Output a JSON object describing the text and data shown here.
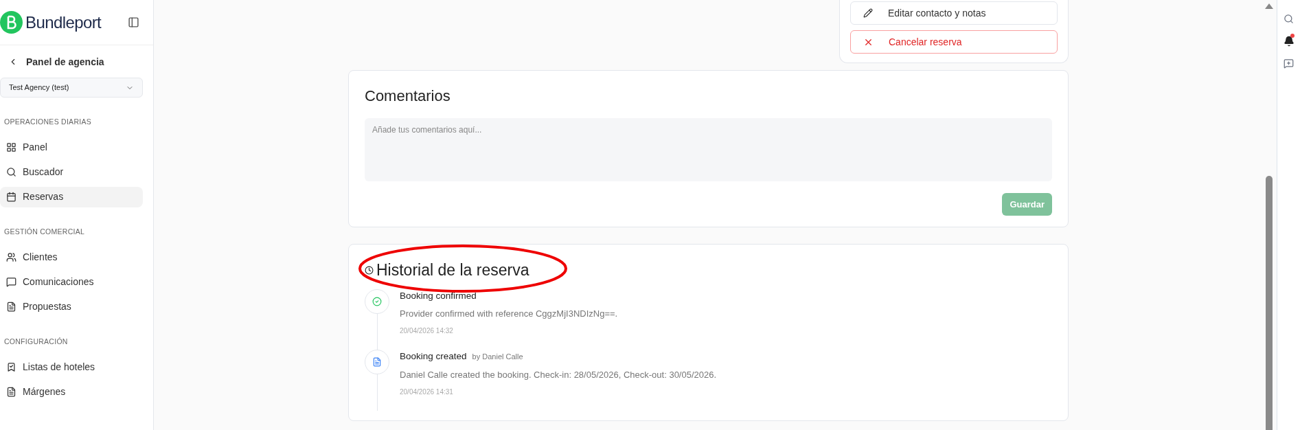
{
  "sidebar": {
    "brand": "Bundleport",
    "back_label": "Panel de agencia",
    "agency_select": "Test Agency (test)",
    "sections": [
      {
        "title": "OPERACIONES DIARIAS",
        "items": [
          {
            "label": "Panel",
            "selected": false
          },
          {
            "label": "Buscador",
            "selected": false
          },
          {
            "label": "Reservas",
            "selected": true
          }
        ]
      },
      {
        "title": "GESTIÓN COMERCIAL",
        "items": [
          {
            "label": "Clientes",
            "selected": false
          },
          {
            "label": "Comunicaciones",
            "selected": false
          },
          {
            "label": "Propuestas",
            "selected": false
          }
        ]
      },
      {
        "title": "CONFIGURACIÓN",
        "items": [
          {
            "label": "Listas de hoteles",
            "selected": false
          },
          {
            "label": "Márgenes",
            "selected": false
          }
        ]
      }
    ]
  },
  "actions": [
    {
      "label": "Editar contacto y notas",
      "kind": "default"
    },
    {
      "label": "Cancelar reserva",
      "kind": "danger"
    }
  ],
  "comments": {
    "title": "Comentarios",
    "placeholder": "Añade tus comentarios aquí...",
    "save_button": "Guardar",
    "save_disabled": true
  },
  "history": {
    "title": "Historial de la reserva",
    "events": [
      {
        "kind": "confirmed",
        "title": "Booking confirmed",
        "description": "Provider confirmed with reference CggzMjI3NDIzNg==.",
        "time": "20/04/2026 14:32"
      },
      {
        "kind": "created",
        "title": "Booking created",
        "by": "by Daniel Calle",
        "description": "Daniel Calle created the booking. Check-in: 28/05/2026, Check-out: 30/05/2026.",
        "time": "20/04/2026 14:31"
      }
    ]
  },
  "rail": {
    "notification_dot": true
  }
}
